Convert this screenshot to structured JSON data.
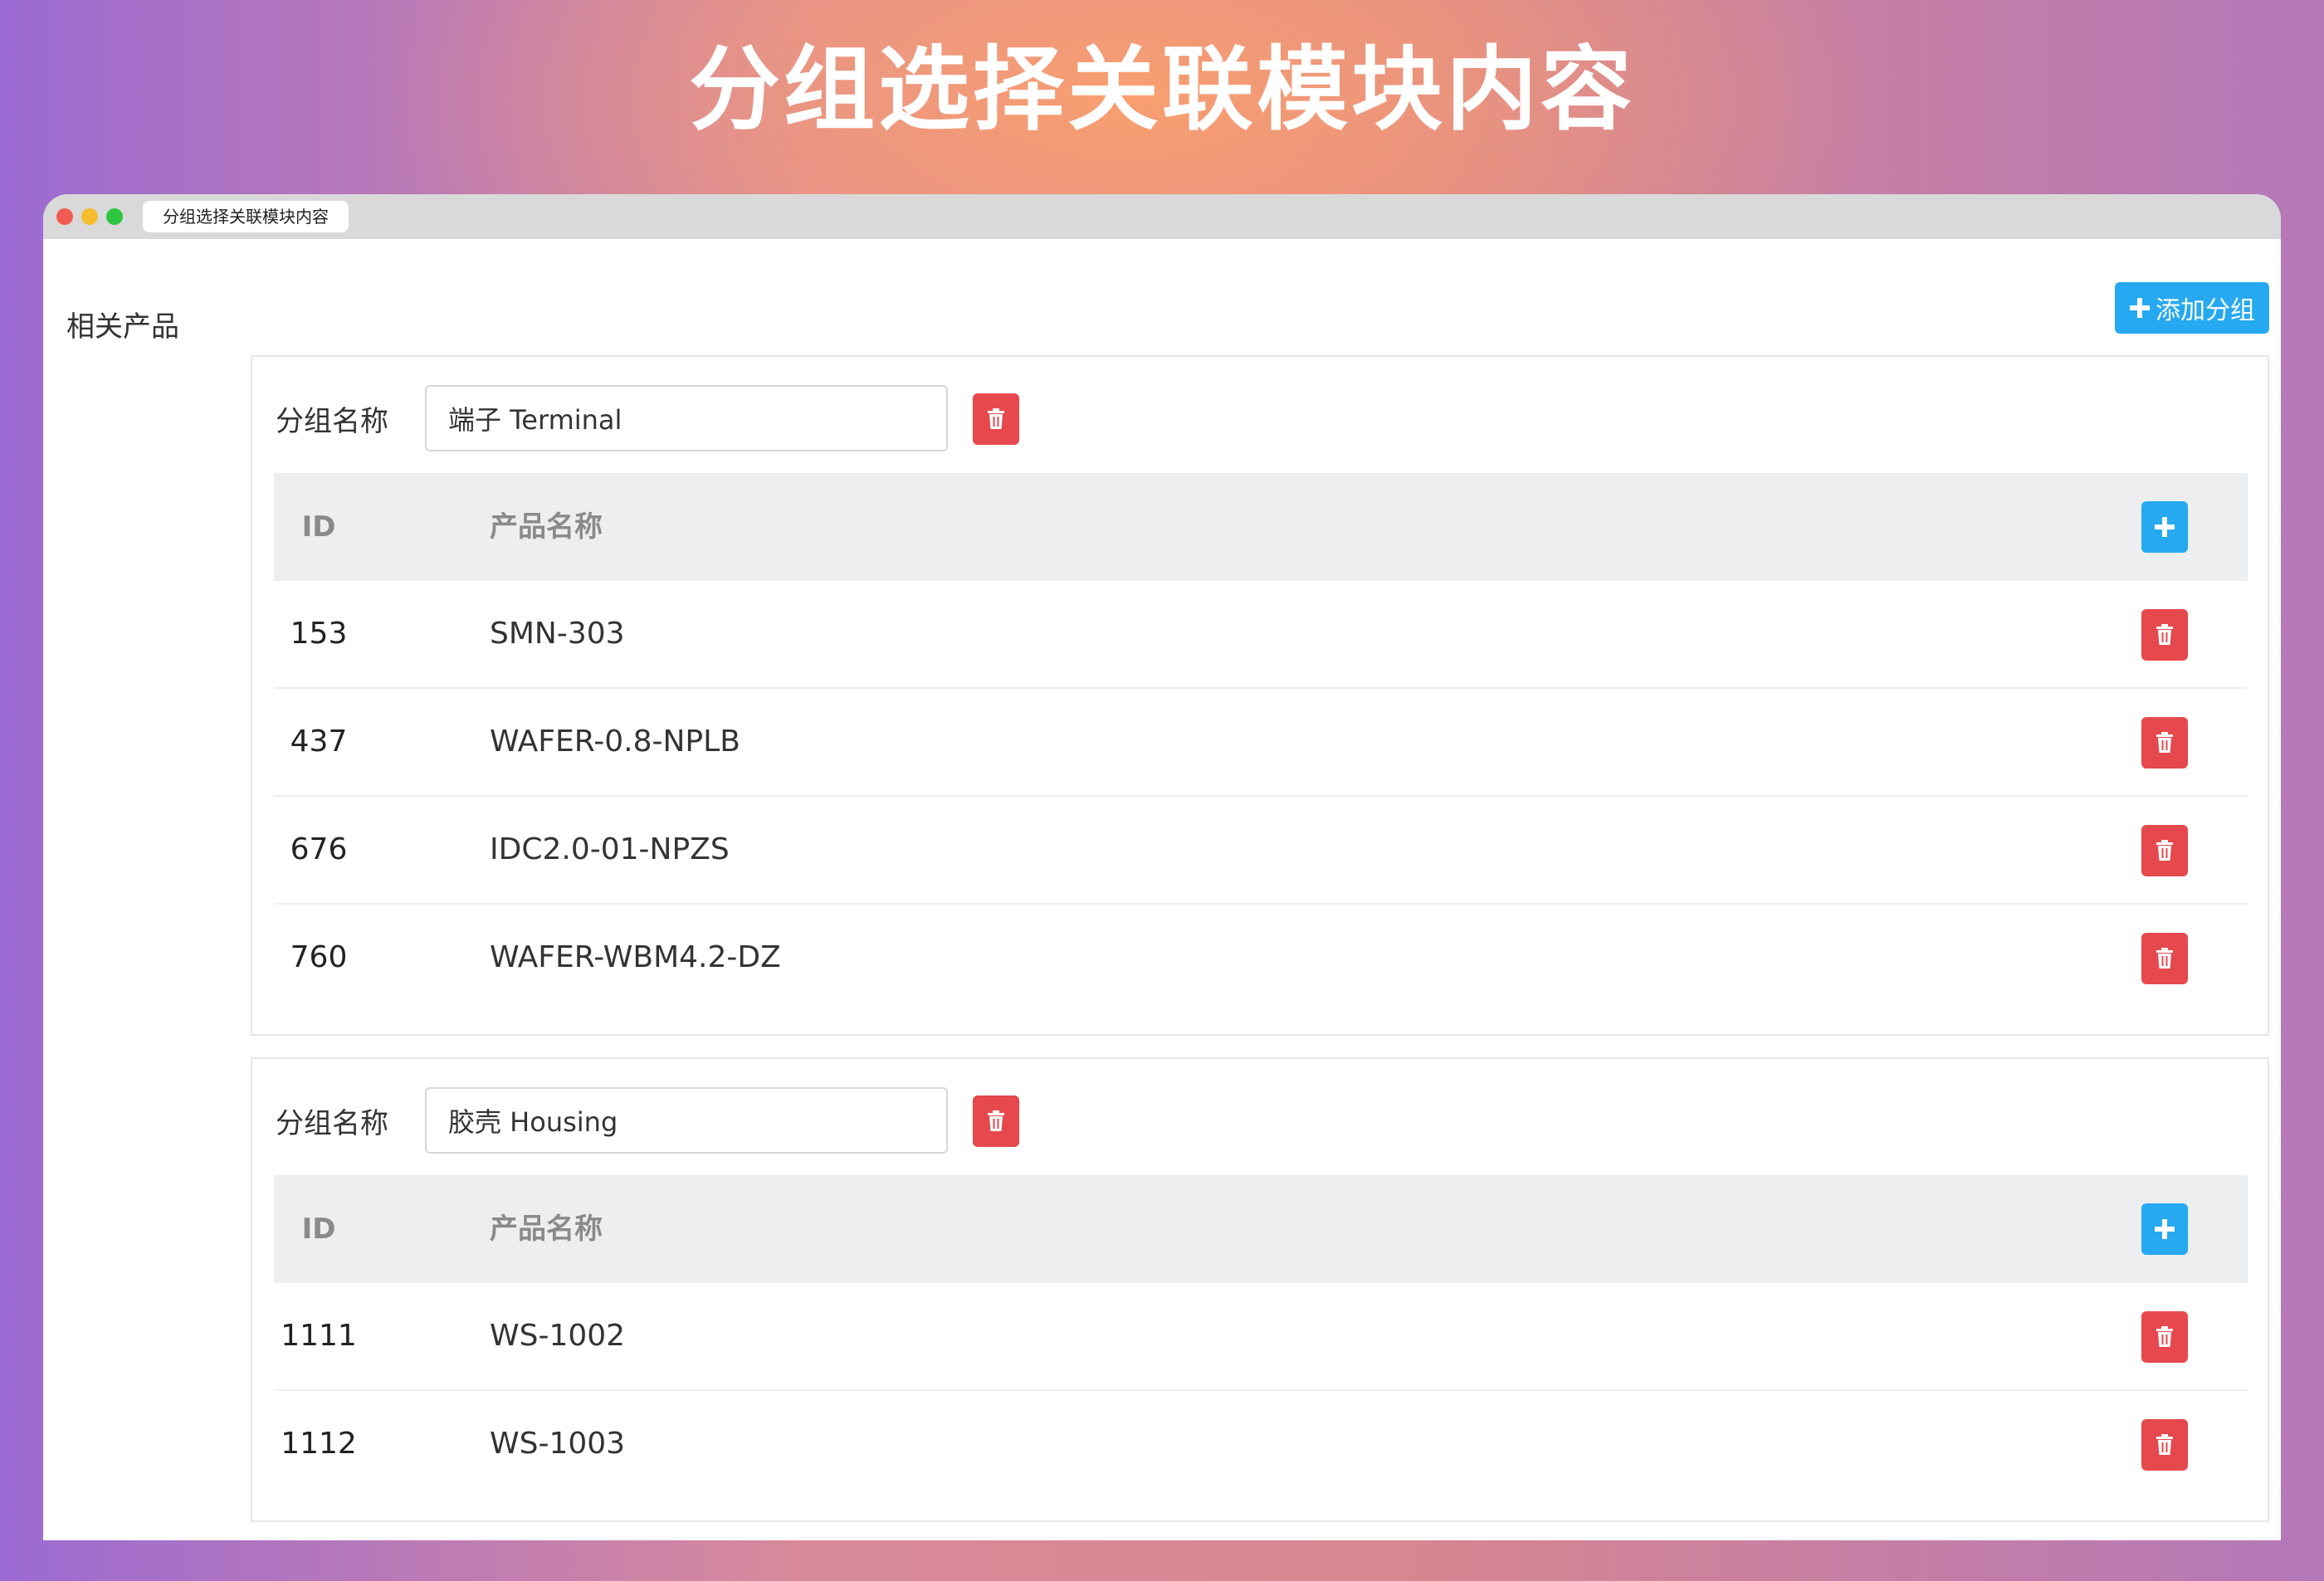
{
  "hero": {
    "title": "分组选择关联模块内容"
  },
  "window": {
    "tab_title": "分组选择关联模块内容"
  },
  "page": {
    "section_label": "相关产品",
    "add_group_label": "添加分组"
  },
  "colors": {
    "primary": "#26a9f0",
    "danger": "#e5484d"
  },
  "groups": [
    {
      "name_label": "分组名称",
      "name_value": "端子 Terminal",
      "columns": {
        "id": "ID",
        "name": "产品名称"
      },
      "rows": [
        {
          "id": "153",
          "name": "SMN-303"
        },
        {
          "id": "437",
          "name": "WAFER-0.8-NPLB"
        },
        {
          "id": "676",
          "name": "IDC2.0-01-NPZS"
        },
        {
          "id": "760",
          "name": "WAFER-WBM4.2-DZ"
        }
      ]
    },
    {
      "name_label": "分组名称",
      "name_value": "胶壳 Housing",
      "columns": {
        "id": "ID",
        "name": "产品名称"
      },
      "rows": [
        {
          "id": "1111",
          "name": "WS-1002"
        },
        {
          "id": "1112",
          "name": "WS-1003"
        }
      ]
    }
  ]
}
